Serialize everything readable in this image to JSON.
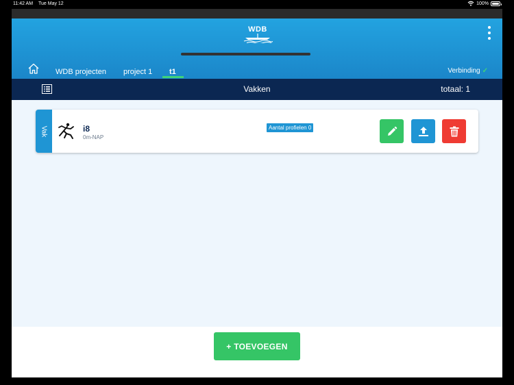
{
  "status_bar": {
    "time": "11:42 AM",
    "date": "Tue May 12",
    "battery": "100%"
  },
  "header": {
    "logo_text": "WDB",
    "tabs": [
      {
        "label": "WDB projecten"
      },
      {
        "label": "project 1"
      },
      {
        "label": "t1",
        "active": true
      }
    ],
    "connection_label": "Verbinding",
    "connection_icon": "check-icon"
  },
  "subbar": {
    "title": "Vakken",
    "total": "totaal: 1"
  },
  "items": [
    {
      "side_label": "Vak",
      "name": "i8",
      "subtitle": "0m-NAP",
      "badge": "Aantal profielen 0",
      "icon": "figure-icon"
    }
  ],
  "actions": {
    "edit_icon": "pencil-icon",
    "upload_icon": "upload-icon",
    "delete_icon": "trash-icon"
  },
  "footer": {
    "add_label": "+ TOEVOEGEN"
  },
  "colors": {
    "header_top": "#23a3e0",
    "header_bottom": "#1b86c9",
    "subbar": "#0b2752",
    "green": "#35c566",
    "blue": "#1f95d4",
    "red": "#ef3b33",
    "background": "#eef6fd"
  }
}
